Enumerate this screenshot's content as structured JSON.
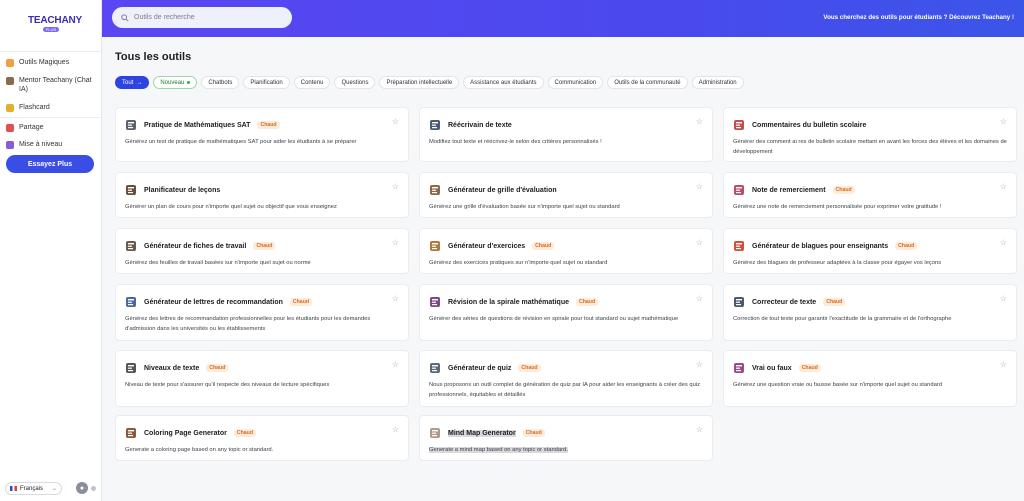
{
  "sidebar": {
    "logo": "TEACHANY",
    "logo_badge": "PLUS",
    "items": [
      {
        "label": "Outils Magiques",
        "icon": "magic-icon",
        "color": "#f0a040"
      },
      {
        "label": "Mentor Teachany (Chat IA)",
        "icon": "mentor-icon",
        "color": "#8b6b4a"
      },
      {
        "label": "Flashcard",
        "icon": "flashcard-icon",
        "color": "#e0b030"
      },
      {
        "label": "Partage",
        "icon": "share-icon",
        "color": "#e05050"
      },
      {
        "label": "Mise à niveau",
        "icon": "upgrade-icon",
        "color": "#8a5ad8"
      }
    ],
    "try_button": "Essayez Plus",
    "language": "Français"
  },
  "topbar": {
    "search_placeholder": "Outils de recherche",
    "promo": "Vous cherchez des outils pour étudiants ? Découvrez Teachany !"
  },
  "main": {
    "title": "Tous les outils",
    "tabs": [
      {
        "label": "Tout",
        "state": "active"
      },
      {
        "label": "Nouveau",
        "state": "new"
      },
      {
        "label": "Chatbots"
      },
      {
        "label": "Planification"
      },
      {
        "label": "Contenu"
      },
      {
        "label": "Questions"
      },
      {
        "label": "Préparation intellectuelle"
      },
      {
        "label": "Assistance aux étudiants"
      },
      {
        "label": "Communication"
      },
      {
        "label": "Outils de la communauté"
      },
      {
        "label": "Administration"
      }
    ],
    "hot_label": "Chaud",
    "cards": [
      {
        "title": "Pratique de Mathématiques SAT",
        "hot": true,
        "icon": "calculator-icon",
        "desc": "Générez un test de pratique de mathématiques SAT pour aider les étudiants à se préparer"
      },
      {
        "title": "Réécrivain de texte",
        "hot": false,
        "icon": "rewrite-icon",
        "desc": "Modifiez tout texte et réécrivez-le selon des critères personnalisés !"
      },
      {
        "title": "Commentaires du bulletin scolaire",
        "hot": false,
        "icon": "report-card-icon",
        "desc": "Générer des comment ai res de bulletin scolaire mettant en avant les forces des élèves et les domaines de développement"
      },
      {
        "title": "Planificateur de leçons",
        "hot": false,
        "icon": "lesson-plan-icon",
        "desc": "Générer un plan de cours pour n'importe quel sujet ou objectif que vous enseignez"
      },
      {
        "title": "Générateur de grille d'évaluation",
        "hot": false,
        "icon": "rubric-icon",
        "desc": "Générez une grille d'évaluation basée sur n'importe quel sujet ou standard"
      },
      {
        "title": "Note de remerciement",
        "hot": true,
        "icon": "thank-you-icon",
        "desc": "Générez une note de remerciement personnalisée pour exprimer votre gratitude !"
      },
      {
        "title": "Générateur de fiches de travail",
        "hot": true,
        "icon": "worksheet-icon",
        "desc": "Générez des feuilles de travail basées sur n'importe quel sujet ou norme"
      },
      {
        "title": "Générateur d'exercices",
        "hot": true,
        "icon": "exercise-icon",
        "desc": "Générez des exercices pratiques sur n'importe quel sujet ou standard"
      },
      {
        "title": "Générateur de blagues pour enseignants",
        "hot": true,
        "icon": "joke-icon",
        "desc": "Générez des blagues de professeur adaptées à la classe pour égayer vos leçons"
      },
      {
        "title": "Générateur de lettres de recommandation",
        "hot": true,
        "icon": "letter-icon",
        "desc": "Générez des lettres de recommandation professionnelles pour les étudiants pour les demandes d'admission dans les universités ou les établissements"
      },
      {
        "title": "Révision de la spirale mathématique",
        "hot": true,
        "icon": "spiral-math-icon",
        "desc": "Générer des séries de questions de révision en spirale pour tout standard ou sujet mathématique"
      },
      {
        "title": "Correcteur de texte",
        "hot": true,
        "icon": "proofread-icon",
        "desc": "Correction de tout texte pour garantir l'exactitude de la grammaire et de l'orthographe"
      },
      {
        "title": "Niveaux de texte",
        "hot": true,
        "icon": "text-level-icon",
        "desc": "Niveau de texte pour s'assurer qu'il respecte des niveaux de lecture spécifiques"
      },
      {
        "title": "Générateur de quiz",
        "hot": true,
        "icon": "quiz-icon",
        "desc": "Nous proposons un outil complet de génération de quiz par IA pour aider les enseignants à créer des quiz professionnels, équitables et détaillés"
      },
      {
        "title": "Vrai ou faux",
        "hot": true,
        "icon": "true-false-icon",
        "desc": "Générez une question vraie ou fausse basée sur n'importe quel sujet ou standard"
      },
      {
        "title": "Coloring Page Generator",
        "hot": true,
        "icon": "coloring-icon",
        "desc": "Generate a coloring page based on any topic or standard."
      },
      {
        "title": "Mind Map Generator",
        "hot": true,
        "icon": "mind-map-icon",
        "desc": "Generate a mind map based on any topic or standard.",
        "highlight": true
      }
    ]
  }
}
